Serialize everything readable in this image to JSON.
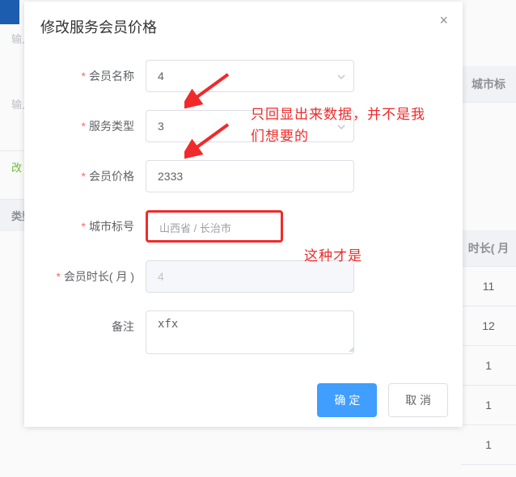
{
  "bg": {
    "search1": "输入",
    "search2": "输入",
    "edit_btn": "改",
    "type_label": "类型",
    "right_col_header": "城市标",
    "right_col_header2": "时长( 月",
    "cells": [
      "11",
      "12",
      "1",
      "1",
      "1"
    ]
  },
  "dialog": {
    "title": "修改服务会员价格",
    "close": "×",
    "form": {
      "member_name": {
        "label": "会员名称",
        "value": "4"
      },
      "service_type": {
        "label": "服务类型",
        "value": "3"
      },
      "member_price": {
        "label": "会员价格",
        "value": "2333"
      },
      "city_code": {
        "label": "城市标号",
        "value": "山西省 / 长治市"
      },
      "member_duration": {
        "label": "会员时长( 月 )",
        "value": "4"
      },
      "remark": {
        "label": "备注",
        "value": "xfx"
      }
    },
    "footer": {
      "ok": "确 定",
      "cancel": "取 消"
    }
  },
  "annotations": {
    "text1": "只回显出来数据，并不是我们想要的",
    "text2": "这种才是"
  }
}
